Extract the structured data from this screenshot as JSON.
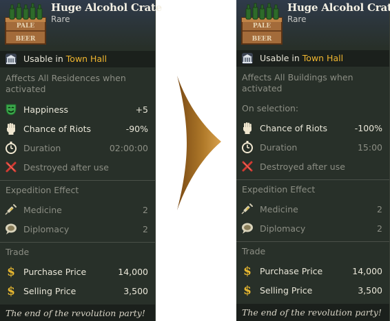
{
  "left": {
    "title": "Huge Alcohol Crate",
    "rarity": "Rare",
    "crate_text": [
      "PALE",
      "BEER"
    ],
    "usable_prefix": "Usable in",
    "usable_place": "Town Hall",
    "description": "Affects All Residences when activated",
    "effects": [
      {
        "icon": "mask-icon",
        "label": "Happiness",
        "value": "+5"
      },
      {
        "icon": "fist-icon",
        "label": "Chance of Riots",
        "value": "-90%"
      },
      {
        "icon": "stopwatch-icon",
        "label": "Duration",
        "value": "02:00:00"
      },
      {
        "icon": "cross-icon",
        "label": "Destroyed after use",
        "value": ""
      }
    ],
    "expedition_title": "Expedition Effect",
    "expedition": [
      {
        "icon": "syringe-icon",
        "label": "Medicine",
        "value": "2"
      },
      {
        "icon": "speech-icon",
        "label": "Diplomacy",
        "value": "2"
      }
    ],
    "trade_title": "Trade",
    "trade": [
      {
        "label": "Purchase Price",
        "value": "14,000"
      },
      {
        "label": "Selling Price",
        "value": "3,500"
      }
    ],
    "flavor": "The end of the revolution party!"
  },
  "right": {
    "title": "Huge Alcohol Crate",
    "rarity": "Rare",
    "crate_text": [
      "PALE",
      "BEER"
    ],
    "usable_prefix": "Usable in",
    "usable_place": "Town Hall",
    "description": "Affects All Buildings when activated",
    "on_selection": "On selection:",
    "effects": [
      {
        "icon": "fist-icon",
        "label": "Chance of Riots",
        "value": "-100%"
      },
      {
        "icon": "stopwatch-icon",
        "label": "Duration",
        "value": "15:00"
      },
      {
        "icon": "cross-icon",
        "label": "Destroyed after use",
        "value": ""
      }
    ],
    "expedition_title": "Expedition Effect",
    "expedition": [
      {
        "icon": "syringe-icon",
        "label": "Medicine",
        "value": "2"
      },
      {
        "icon": "speech-icon",
        "label": "Diplomacy",
        "value": "2"
      }
    ],
    "trade_title": "Trade",
    "trade": [
      {
        "label": "Purchase Price",
        "value": "14,000"
      },
      {
        "label": "Selling Price",
        "value": "3,500"
      }
    ],
    "flavor": "The end of the revolution party!"
  },
  "colors": {
    "panel": "#283029",
    "highlight": "#f0b630",
    "dim_text": "#8c8e84",
    "arrow": "#b07a2a"
  }
}
